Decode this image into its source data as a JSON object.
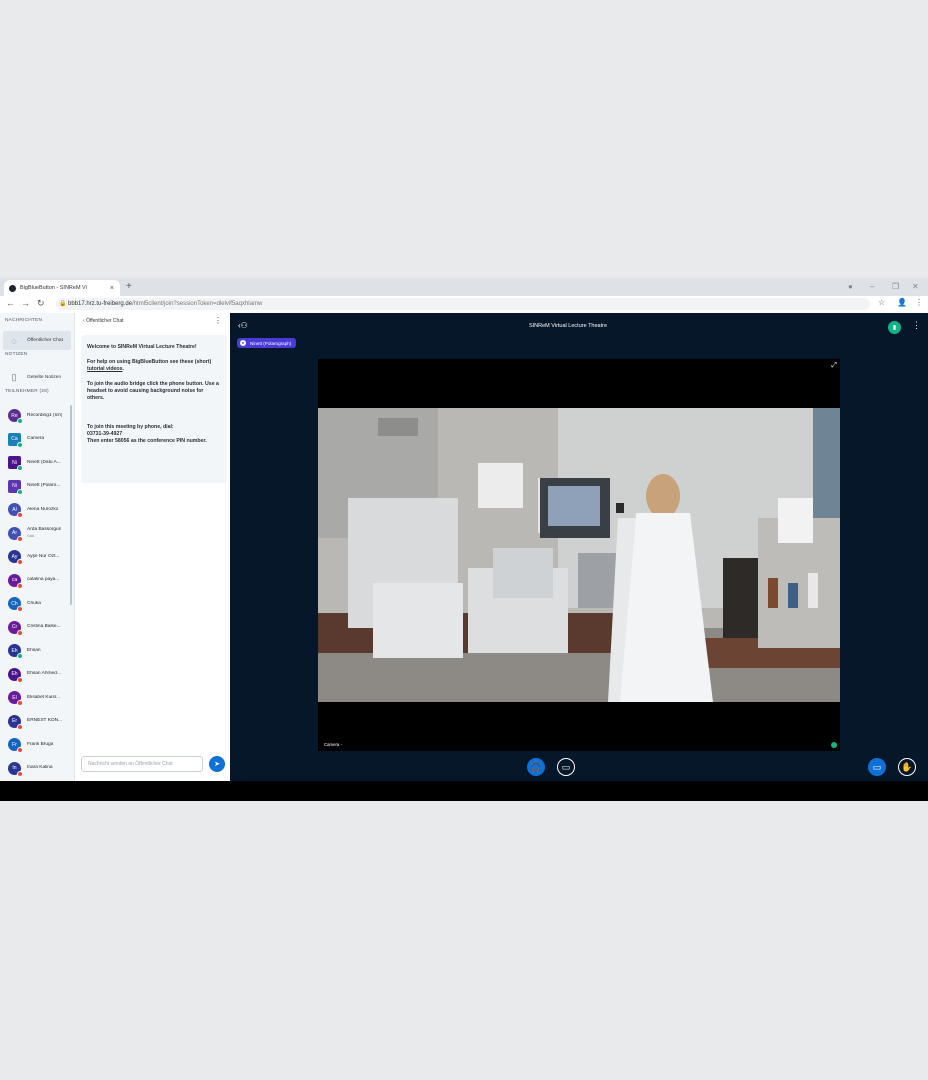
{
  "browser": {
    "tab_title": "BigBlueButton - SINReM Vi",
    "tab_close": "×",
    "new_tab": "+",
    "url_host": "bbb17.hrz.tu-freiberg.de",
    "url_path": "/html5client/join?sessionToken=dlelvif5aqxhlamw"
  },
  "sidebar": {
    "messages_header": "NACHRICHTEN",
    "public_chat": "Öffentlicher Chat",
    "notes_header": "NOTIZEN",
    "shared_notes": "Geteilte Notizen",
    "participants_header": "TEILNEHMER (29)",
    "users": [
      {
        "initials": "Re",
        "name": "Recording1 (Ich)",
        "color": "#5b2c91",
        "badge": "#11b486"
      },
      {
        "initials": "Ca",
        "name": "Camera",
        "color": "#1b7fb8",
        "badge": "#11b486",
        "square": true
      },
      {
        "initials": "Ni",
        "name": "Ninett (Datu A...",
        "color": "#4a148c",
        "badge": "#11b486",
        "square": true
      },
      {
        "initials": "Ni",
        "name": "Ninett (Polaro...",
        "color": "#5e35b1",
        "badge": "#11b486",
        "square": true
      },
      {
        "initials": "Al",
        "name": "Alena Nurozko",
        "color": "#3f51b5",
        "badge": "#e74c3c"
      },
      {
        "initials": "Ar",
        "name": "Arda Bassorgun",
        "sub": "Gast",
        "color": "#3f51b5",
        "badge": "#e74c3c"
      },
      {
        "initials": "Ay",
        "name": "Ayşe Nur Özt...",
        "color": "#283593",
        "badge": "#e74c3c"
      },
      {
        "initials": "ca",
        "name": "catalina paya...",
        "color": "#6a1b9a",
        "badge": "#e74c3c"
      },
      {
        "initials": "Ch",
        "name": "Chuka",
        "color": "#1565c0",
        "badge": "#e74c3c"
      },
      {
        "initials": "Cr",
        "name": "Cristina Balse...",
        "color": "#6a1b9a",
        "badge": "#e74c3c"
      },
      {
        "initials": "Eh",
        "name": "Ehsan",
        "color": "#283593",
        "badge": "#11b486"
      },
      {
        "initials": "Eh",
        "name": "Ehsan Ahmed...",
        "color": "#4a148c",
        "badge": "#e74c3c"
      },
      {
        "initials": "El",
        "name": "Elisabet Kuisr...",
        "color": "#6a1b9a",
        "badge": "#e74c3c"
      },
      {
        "initials": "Er",
        "name": "ERNEST KON...",
        "color": "#283593",
        "badge": "#e74c3c"
      },
      {
        "initials": "Fr",
        "name": "Frank Bruga",
        "color": "#1565c0",
        "badge": "#e74c3c"
      },
      {
        "initials": "In",
        "name": "Inara Kalina",
        "color": "#283593",
        "badge": "#e74c3c"
      }
    ]
  },
  "chat": {
    "back_label": "Öffentlicher Chat",
    "welcome_prefix": "Welcome to ",
    "welcome_name": "SINReM Virtual Lecture Theatre",
    "welcome_suffix": "!",
    "help_prefix": "For help on using BigBlueButton see these (short) ",
    "help_link": "tutorial videos",
    "help_suffix": ".",
    "audio_text": "To join the audio bridge click the phone button. Use a headset to avoid causing background noise for others.",
    "phone_line1": "To join this meeting by phone, dial:",
    "phone_number": "03731-39-4927",
    "phone_line3": "Then enter 58056 as the conference PIN number.",
    "input_placeholder": "Nachricht senden an Öffentlicher Chat"
  },
  "main": {
    "title": "SINReM Virtual Lecture Theatre",
    "talking_user": "Ninett (Polarograph)",
    "camera_label": "Camera -"
  },
  "colors": {
    "primary": "#0f70d7",
    "success": "#11b486",
    "danger": "#e74c3c",
    "main_bg": "#06172a"
  }
}
